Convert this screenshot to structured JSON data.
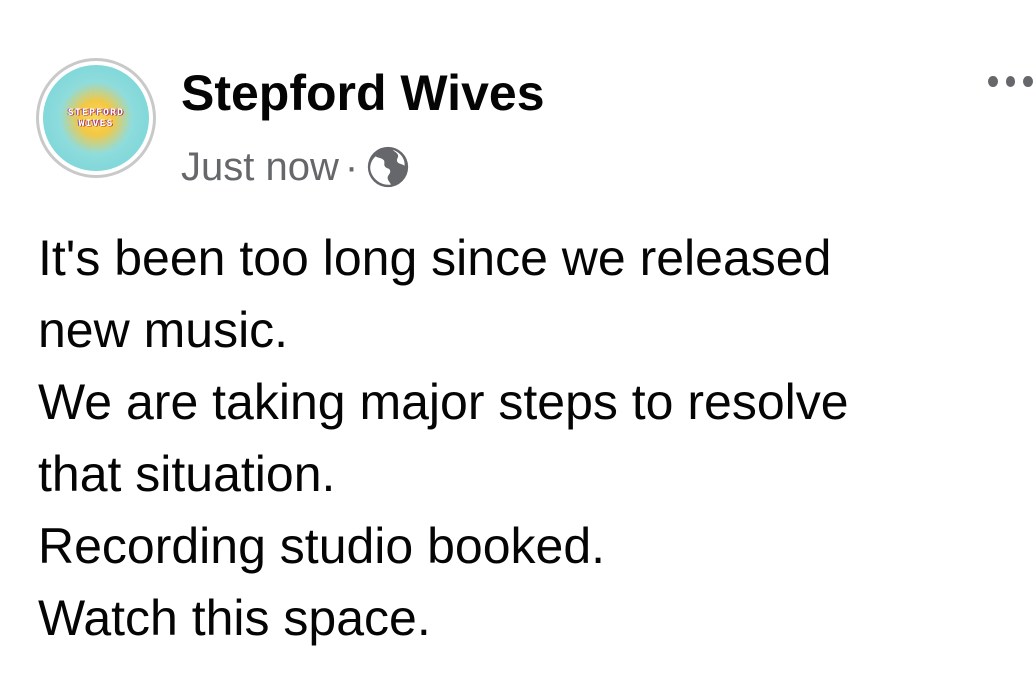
{
  "post": {
    "author": {
      "name": "Stepford Wives",
      "avatar_text": [
        "STEPFORD",
        "WIVES"
      ]
    },
    "timestamp": "Just now",
    "separator": "·",
    "audience_icon": "globe-icon",
    "more_icon": "more-options-icon",
    "lines": [
      "It's been too long since we released",
      "new music.",
      "We are taking major steps to resolve",
      "that situation.",
      "Recording studio booked.",
      "Watch this space."
    ]
  },
  "colors": {
    "text_primary": "#050505",
    "text_secondary": "#65676b",
    "background": "#ffffff"
  }
}
